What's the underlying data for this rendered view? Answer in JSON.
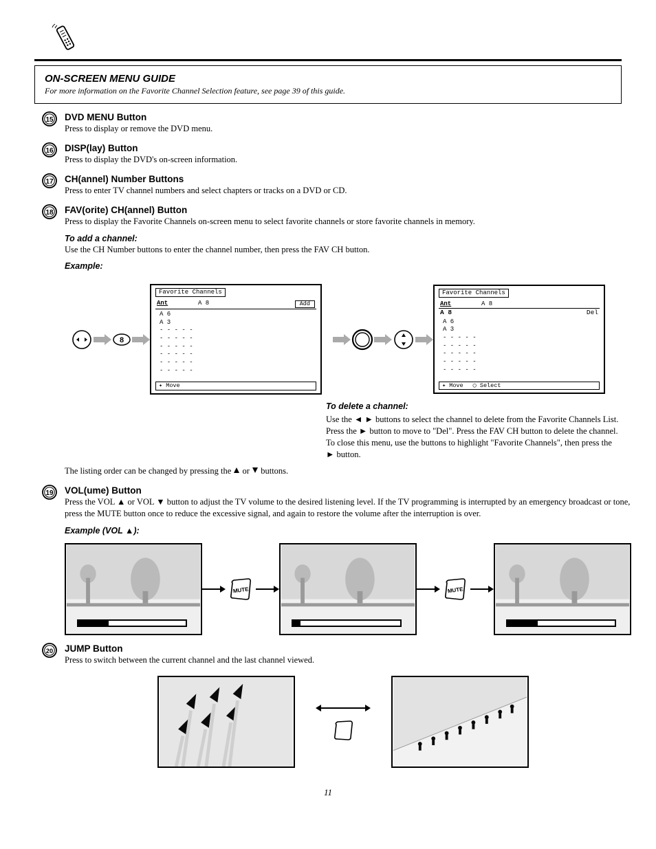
{
  "guide": {
    "title": "ON-SCREEN MENU GUIDE",
    "text": "For more information on the Favorite Channel Selection feature, see page 39 of this guide."
  },
  "items": {
    "dvdmenu": {
      "title": "DVD MENU Button",
      "desc": "Press to display or remove the DVD menu."
    },
    "disp": {
      "title": "DISP(lay) Button",
      "desc": "Press to display the DVD's on-screen information."
    },
    "chnum": {
      "title": "CH(annel) Number Buttons",
      "desc": "Press to enter TV channel numbers and select chapters or tracks on a DVD or CD."
    },
    "favch": {
      "title": "FAV(orite) CH(annel) Button",
      "desc": "Press to display the Favorite Channels on-screen menu to select favorite channels or store favorite channels in memory.",
      "addTitle": "To add a channel:",
      "addDesc": "Use the CH Number buttons to enter the channel number, then press the FAV CH button.",
      "exTitle": "Example:",
      "exDesc": "The listing order can be changed by pressing the ▲ or ▼ buttons.",
      "delTitle": "To delete a channel:",
      "delText1": "Use the ◄ ► buttons to select the channel to delete from the Favorite Channels List. Press the ► button to move to \"Del\". Press the FAV CH button to delete the channel. To close this menu, use the   buttons to highlight \"Favorite Channels\", then press the ► button."
    },
    "vol": {
      "title": "VOL(ume) Button",
      "desc": "Press the VOL ▲ or VOL ▼ button to adjust the TV volume to the desired listening level. If the TV programming is interrupted by an emergency broadcast or tone, press the MUTE button once to reduce the excessive signal, and again to restore the volume after the interruption is over.",
      "exTitle2": "Example (VOL ▲):"
    },
    "jump": {
      "title": "JUMP Button",
      "desc": "Press to switch between the current channel and the last channel viewed."
    }
  },
  "screen": {
    "title": "Favorite Channels",
    "ant": "Ant",
    "ch": "A 8",
    "add": "Add",
    "del": "Del",
    "list1": [
      "A 6",
      "A 3",
      "- - - - -",
      "- - - - -",
      "- - - - -",
      "- - - - -",
      "- - - - -",
      "- - - - -"
    ],
    "list2": [
      "A 8",
      "A 6",
      "A 3",
      "- - - - -",
      "- - - - -",
      "- - - - -",
      "- - - - -",
      "- - - - -"
    ],
    "move": "Move",
    "select": "Select"
  },
  "numBubble": "8",
  "volFill1": "28%",
  "volFill2": "7%",
  "volFill3": "28%",
  "pageNum": "11",
  "muteBtn": "MUTE"
}
